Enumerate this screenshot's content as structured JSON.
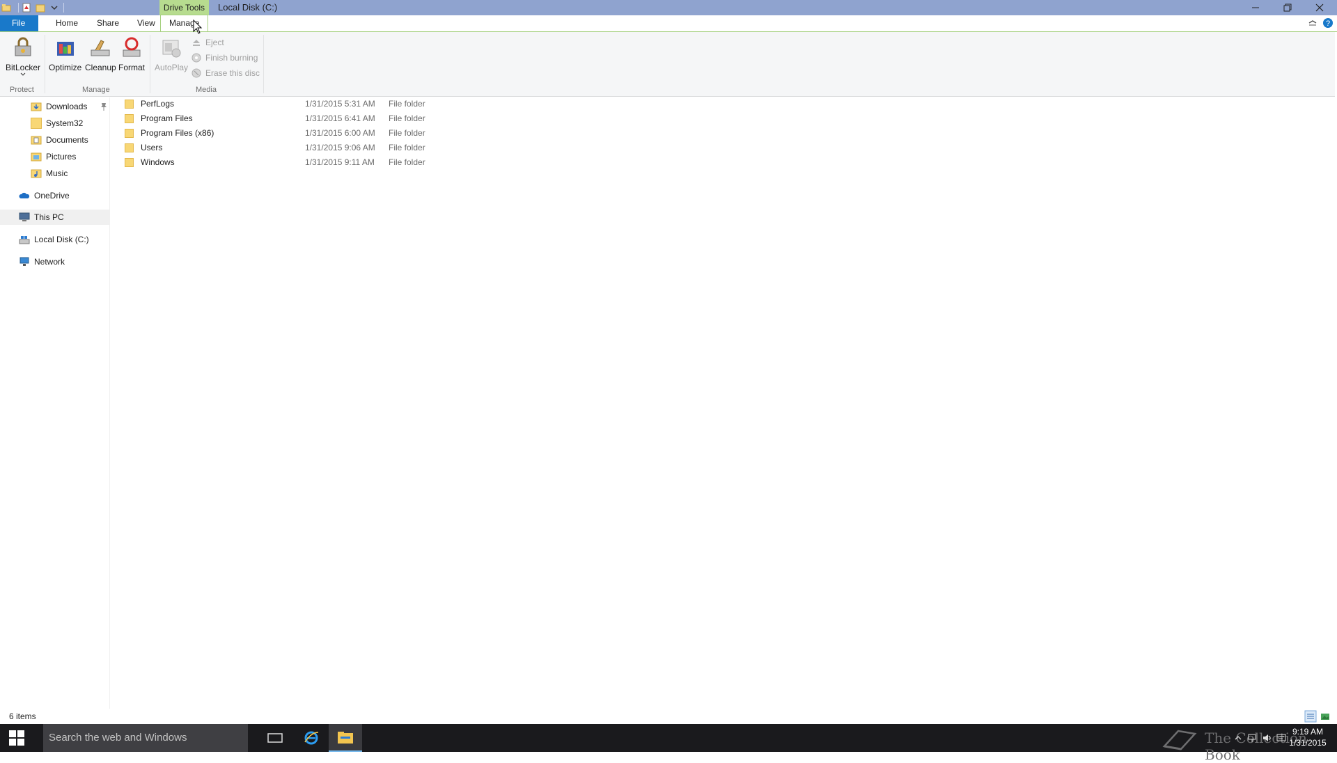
{
  "titlebar": {
    "context_tab": "Drive Tools",
    "title": "Local Disk (C:)"
  },
  "tabs": {
    "file": "File",
    "home": "Home",
    "share": "Share",
    "view": "View",
    "manage": "Manage"
  },
  "ribbon": {
    "protect": {
      "label": "Protect",
      "bitlocker": "BitLocker"
    },
    "manage": {
      "label": "Manage",
      "optimize": "Optimize",
      "cleanup": "Cleanup",
      "format": "Format"
    },
    "media": {
      "label": "Media",
      "autoplay": "AutoPlay",
      "eject": "Eject",
      "finish_burning": "Finish burning",
      "erase": "Erase this disc"
    }
  },
  "nav": {
    "downloads": "Downloads",
    "system32": "System32",
    "documents": "Documents",
    "pictures": "Pictures",
    "music": "Music",
    "onedrive": "OneDrive",
    "thispc": "This PC",
    "localdisk": "Local Disk (C:)",
    "network": "Network"
  },
  "files": [
    {
      "name": "PerfLogs",
      "date": "1/31/2015 5:31 AM",
      "type": "File folder"
    },
    {
      "name": "Program Files",
      "date": "1/31/2015 6:41 AM",
      "type": "File folder"
    },
    {
      "name": "Program Files (x86)",
      "date": "1/31/2015 6:00 AM",
      "type": "File folder"
    },
    {
      "name": "Users",
      "date": "1/31/2015 9:06 AM",
      "type": "File folder"
    },
    {
      "name": "Windows",
      "date": "1/31/2015 9:11 AM",
      "type": "File folder"
    }
  ],
  "status": {
    "count": "6 items"
  },
  "taskbar": {
    "search_placeholder": "Search the web and Windows",
    "watermark": "The Collection Book",
    "time": "9:19 AM",
    "date": "1/31/2015"
  },
  "colors": {
    "titlebar": "#8fa3cf",
    "drive_tools": "#b7dc8f",
    "file_tab": "#1979ca",
    "taskbar": "#1a1a1d"
  }
}
